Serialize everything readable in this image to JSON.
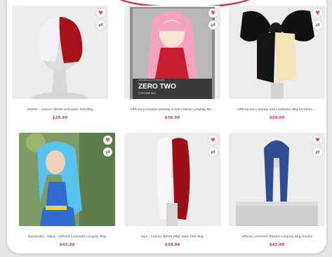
{
  "products": [
    {
      "title": "Aether - Classic White and Dark Red Wig",
      "price": "$29.99",
      "image": "white-red-short-wig",
      "box_top": "",
      "box_title": "",
      "box_sub": ""
    },
    {
      "title": "Official Licensed Darling in the Franxx Cosplay Wi...",
      "price": "$38.99",
      "image": "zero-two-costume-box",
      "box_top": "DARLING IN THE FRANXX",
      "box_title": "ZERO TWO",
      "box_sub": "COSTUME WIG"
    },
    {
      "title": "Official Sia Cosplay and Costume Wig Includes ...",
      "price": "$29.99",
      "image": "sia-bow-wig",
      "box_top": "",
      "box_title": "",
      "box_sub": ""
    },
    {
      "title": "Konosuba - Aqua - Official Licensed Cosplay Wig",
      "price": "$43.99",
      "image": "aqua-blue-cosplay",
      "box_top": "",
      "box_title": "",
      "box_sub": ""
    },
    {
      "title": "Nyx - Classic White AND Dark Red Wig",
      "price": "$38.99",
      "image": "white-red-long-wig",
      "box_top": "",
      "box_title": "",
      "box_sub": ""
    },
    {
      "title": "Official Licensed Naruto Cosplay Wig Hinata",
      "price": "$42.99",
      "image": "hinata-navy-wig",
      "box_top": "",
      "box_title": "",
      "box_sub": ""
    }
  ],
  "icons": {
    "wishlist": "heart-icon",
    "compare": "compare-icon"
  },
  "colors": {
    "price": "#d6324f",
    "accent": "#c43a52"
  }
}
